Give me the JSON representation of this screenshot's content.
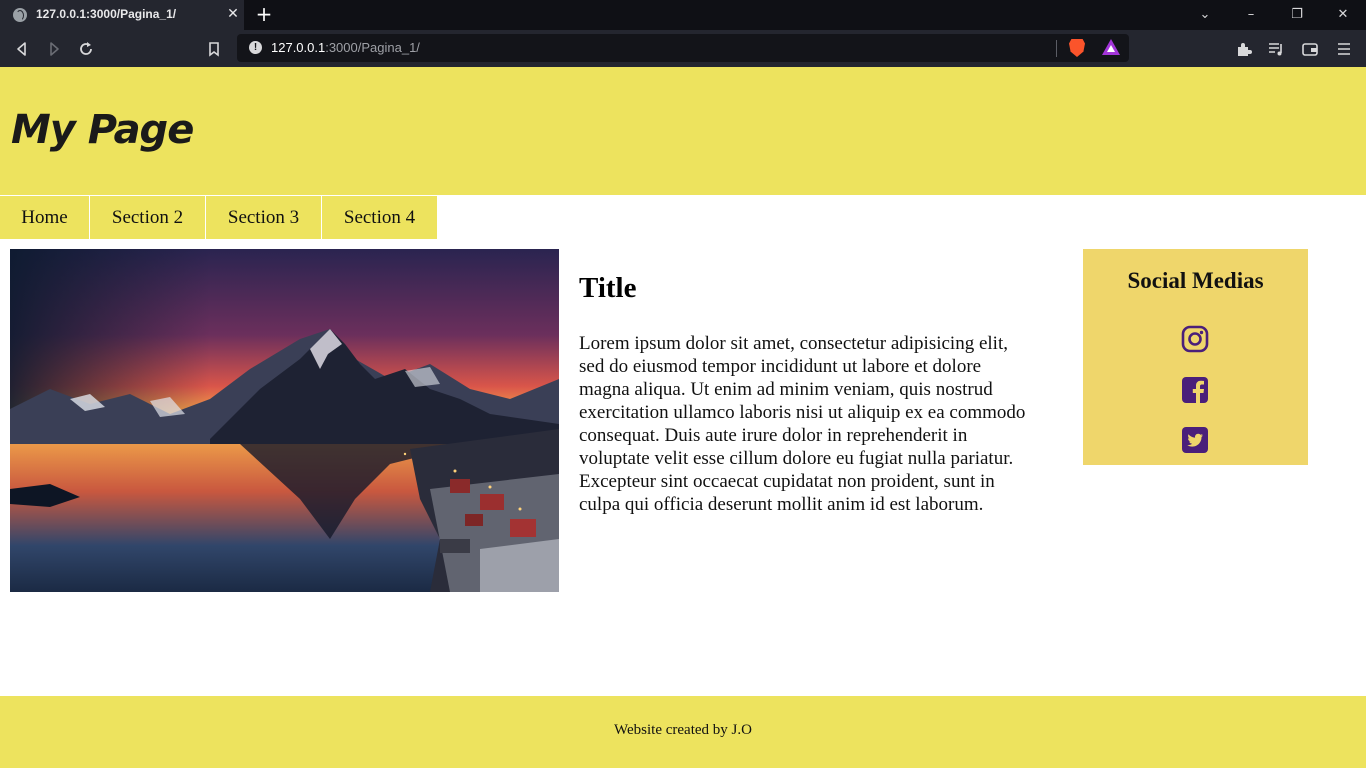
{
  "browser": {
    "tab_title": "127.0.0.1:3000/Pagina_1/",
    "url_host": "127.0.0.1",
    "url_rest": ":3000/Pagina_1/",
    "icons": [
      "globe-icon",
      "close-icon",
      "plus-icon",
      "chevron-down-icon",
      "minimize-icon",
      "restore-icon",
      "window-close-icon",
      "back-icon",
      "forward-icon",
      "reload-icon",
      "bookmark-icon",
      "info-icon",
      "brave-shield-icon",
      "brave-rewards-icon",
      "extensions-icon",
      "playlist-icon",
      "wallet-icon",
      "menu-icon"
    ]
  },
  "header": {
    "title": "My Page"
  },
  "nav": {
    "items": [
      {
        "label": "Home"
      },
      {
        "label": "Section 2"
      },
      {
        "label": "Section 3"
      },
      {
        "label": "Section 4"
      }
    ]
  },
  "main": {
    "image_description_icon": "landscape-photo",
    "title": "Title",
    "body": "Lorem ipsum dolor sit amet, consectetur adipisicing elit, sed do eiusmod tempor incididunt ut labore et dolore magna aliqua. Ut enim ad minim veniam, quis nostrud exercitation ullamco laboris nisi ut aliquip ex ea commodo consequat. Duis aute irure dolor in reprehenderit in voluptate velit esse cillum dolore eu fugiat nulla pariatur. Excepteur sint occaecat cupidatat non proident, sunt in culpa qui officia deserunt mollit anim id est laborum."
  },
  "sidebar": {
    "title": "Social Medias",
    "links": [
      "instagram-icon",
      "facebook-icon",
      "twitter-icon"
    ]
  },
  "footer": {
    "text": "Website created by J.O"
  },
  "colors": {
    "accent_yellow": "#ede35e",
    "sidebar_yellow": "#efd66b",
    "icon_purple": "#4a1f7a"
  }
}
